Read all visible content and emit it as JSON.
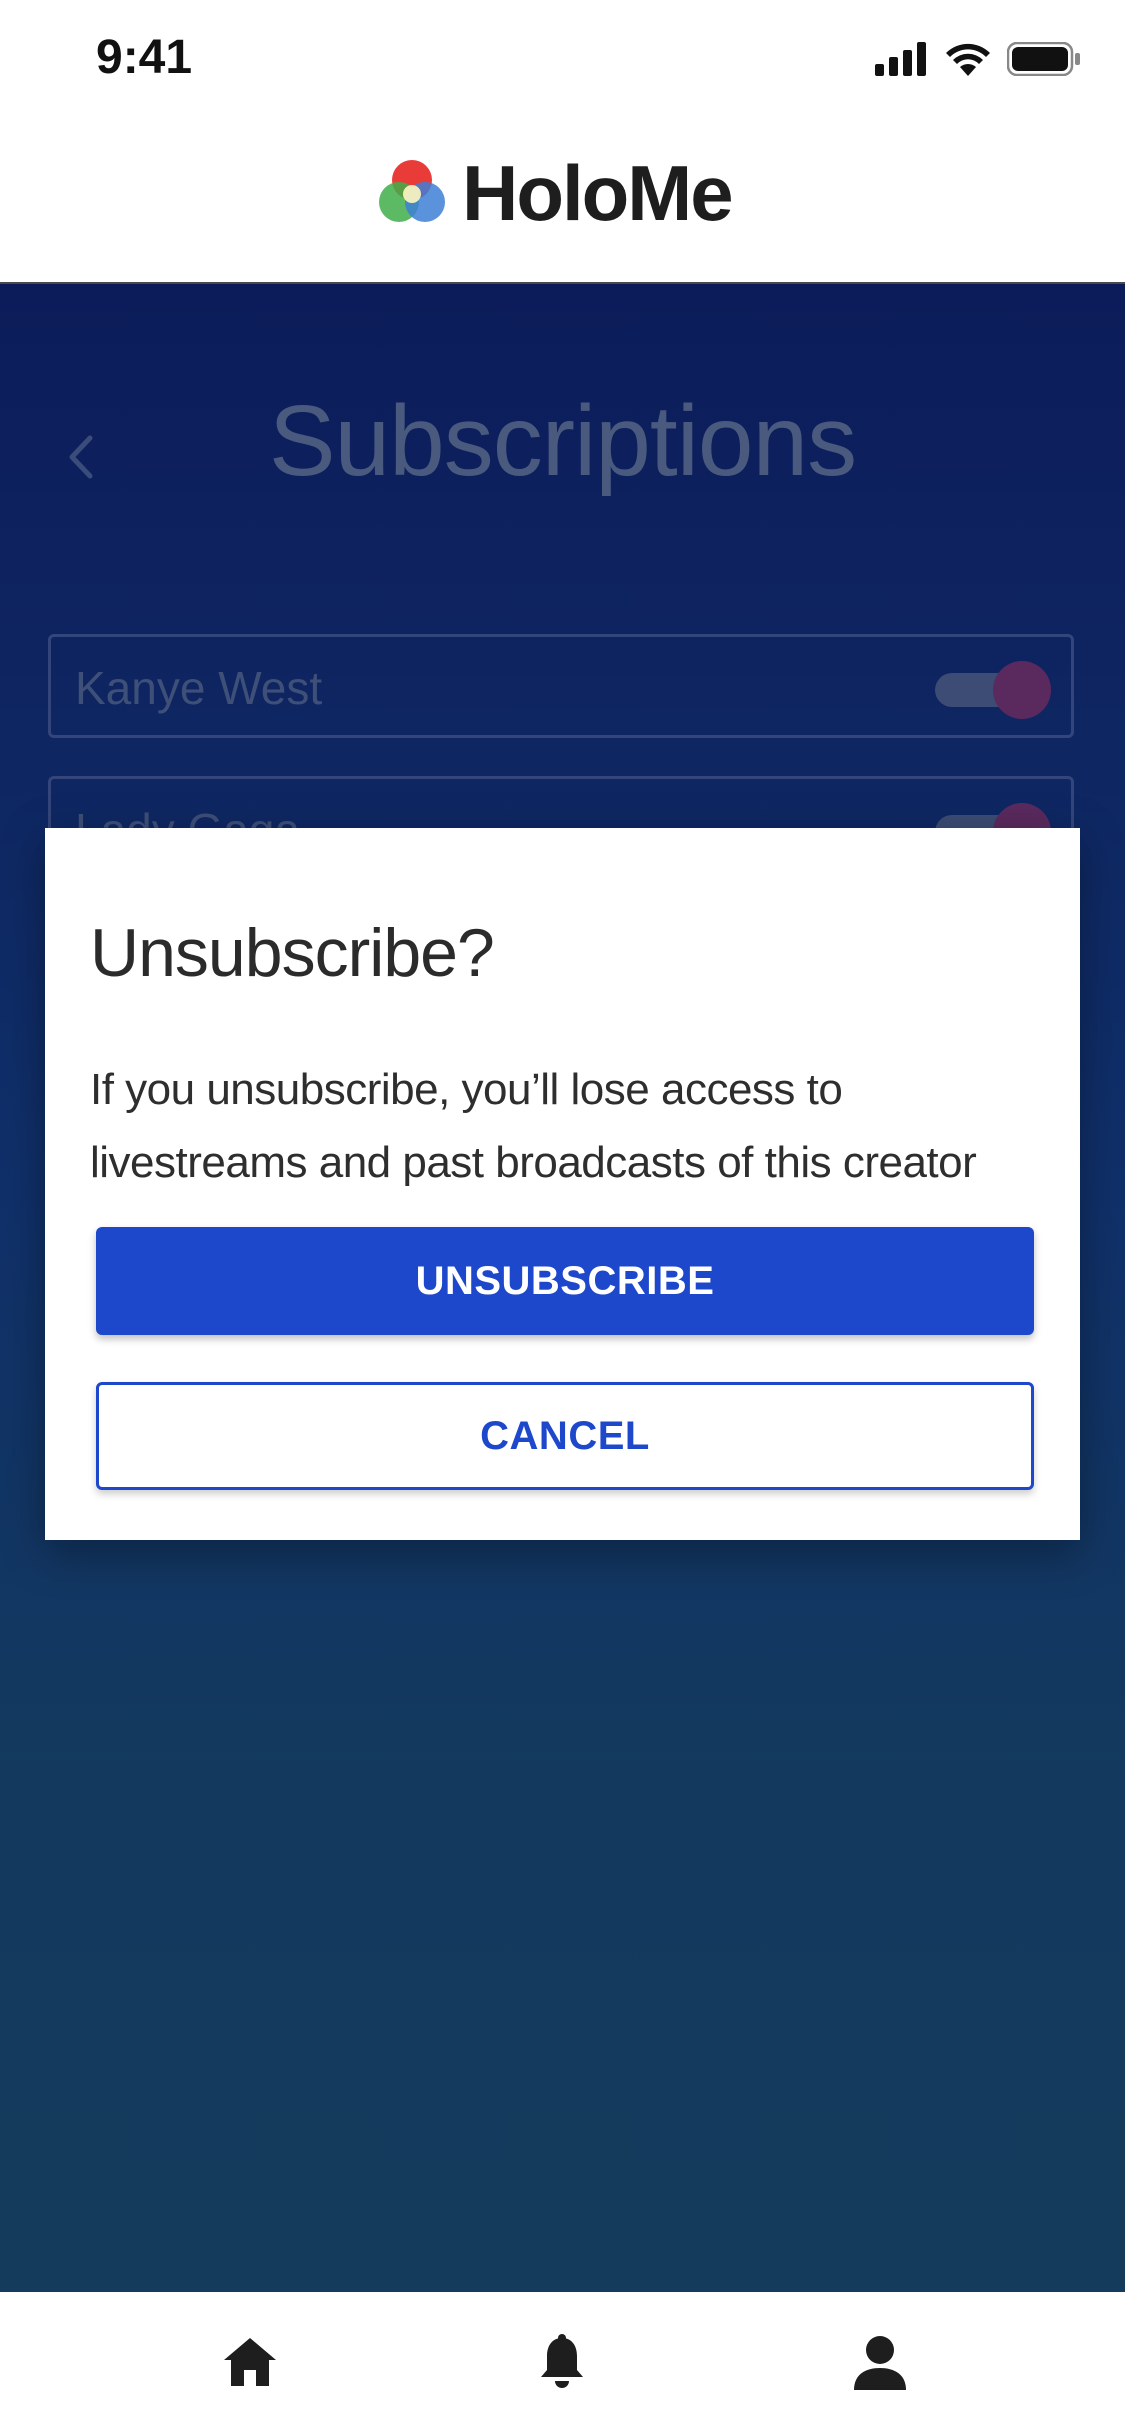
{
  "status_bar": {
    "time": "9:41"
  },
  "header": {
    "brand_name": "HoloMe",
    "logo_colors": [
      "#e8322e",
      "#3fae49",
      "#3d7fd6"
    ]
  },
  "page": {
    "title": "Subscriptions",
    "subscriptions": [
      {
        "name": "Kanye West",
        "subscribed": true
      },
      {
        "name": "Lady Gaga",
        "subscribed": true
      }
    ]
  },
  "dialog": {
    "title": "Unsubscribe?",
    "message": "If you unsubscribe, you’ll lose access to livestreams and past broadcasts of this creator",
    "confirm_label": "UNSUBSCRIBE",
    "cancel_label": "CANCEL"
  },
  "bottom_nav": {
    "items": [
      {
        "icon": "home-icon"
      },
      {
        "icon": "bell-icon"
      },
      {
        "icon": "profile-icon"
      }
    ]
  },
  "colors": {
    "accent": "#1e48cc",
    "background_top": "#0c1c5a",
    "background_bottom": "#143a5c"
  }
}
